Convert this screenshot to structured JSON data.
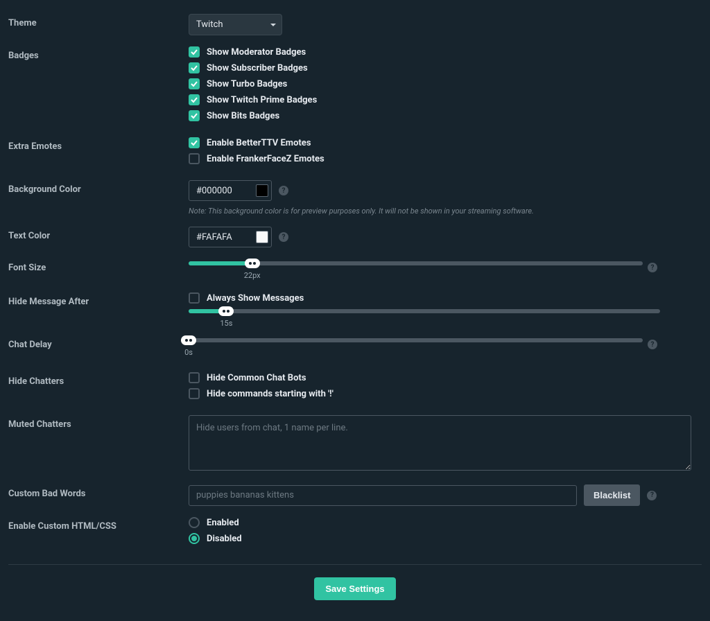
{
  "theme": {
    "label": "Theme",
    "value": "Twitch"
  },
  "badges": {
    "label": "Badges",
    "items": [
      {
        "label": "Show Moderator Badges",
        "checked": true
      },
      {
        "label": "Show Subscriber Badges",
        "checked": true
      },
      {
        "label": "Show Turbo Badges",
        "checked": true
      },
      {
        "label": "Show Twitch Prime Badges",
        "checked": true
      },
      {
        "label": "Show Bits Badges",
        "checked": true
      }
    ]
  },
  "extra_emotes": {
    "label": "Extra Emotes",
    "items": [
      {
        "label": "Enable BetterTTV Emotes",
        "checked": true
      },
      {
        "label": "Enable FrankerFaceZ Emotes",
        "checked": false
      }
    ]
  },
  "bg_color": {
    "label": "Background Color",
    "value": "#000000",
    "swatch": "#000000",
    "note": "Note: This background color is for preview purposes only. It will not be shown in your streaming software."
  },
  "text_color": {
    "label": "Text Color",
    "value": "#FAFAFA",
    "swatch": "#FAFAFA"
  },
  "font_size": {
    "label": "Font Size",
    "value_label": "22px",
    "percent": 14
  },
  "hide_after": {
    "label": "Hide Message After",
    "always_show": {
      "label": "Always Show Messages",
      "checked": false
    },
    "value_label": "15s",
    "percent": 8
  },
  "chat_delay": {
    "label": "Chat Delay",
    "value_label": "0s",
    "percent": 0
  },
  "hide_chatters": {
    "label": "Hide Chatters",
    "items": [
      {
        "label": "Hide Common Chat Bots",
        "checked": false
      },
      {
        "label": "Hide commands starting with '!'",
        "checked": false
      }
    ]
  },
  "muted_chatters": {
    "label": "Muted Chatters",
    "placeholder": "Hide users from chat, 1 name per line."
  },
  "bad_words": {
    "label": "Custom Bad Words",
    "placeholder": "puppies bananas kittens",
    "button": "Blacklist"
  },
  "custom_html": {
    "label": "Enable Custom HTML/CSS",
    "enabled_label": "Enabled",
    "disabled_label": "Disabled",
    "value": "disabled"
  },
  "save_button": "Save Settings"
}
